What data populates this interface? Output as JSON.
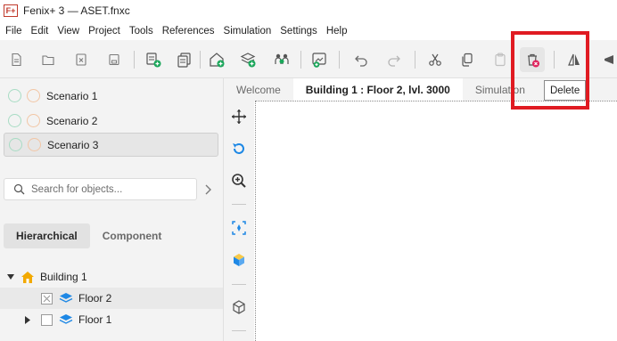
{
  "window": {
    "app_logo": "F+",
    "title": "Fenix+ 3 — ASET.fnxc"
  },
  "menu": [
    "File",
    "Edit",
    "View",
    "Project",
    "Tools",
    "References",
    "Simulation",
    "Settings",
    "Help"
  ],
  "toolbar": {
    "tooltip": "Delete"
  },
  "scenarios": [
    {
      "label": "Scenario 1",
      "selected": false
    },
    {
      "label": "Scenario 2",
      "selected": false
    },
    {
      "label": "Scenario 3",
      "selected": true
    }
  ],
  "search": {
    "placeholder": "Search for objects..."
  },
  "view_toggle": {
    "hierarchical": "Hierarchical",
    "component": "Component"
  },
  "tree": {
    "building": "Building 1",
    "floor2": "Floor 2",
    "floor1": "Floor 1"
  },
  "tabs": {
    "welcome": "Welcome",
    "floor_plan": "Building 1 : Floor 2, lvl. 3000",
    "simulation": "Simulation"
  },
  "colors": {
    "highlight": "#e01b22",
    "accent_green": "#1aa65a",
    "accent_blue": "#1e88e5",
    "building_icon": "#f2a900",
    "delete_badge": "#e0245e"
  }
}
